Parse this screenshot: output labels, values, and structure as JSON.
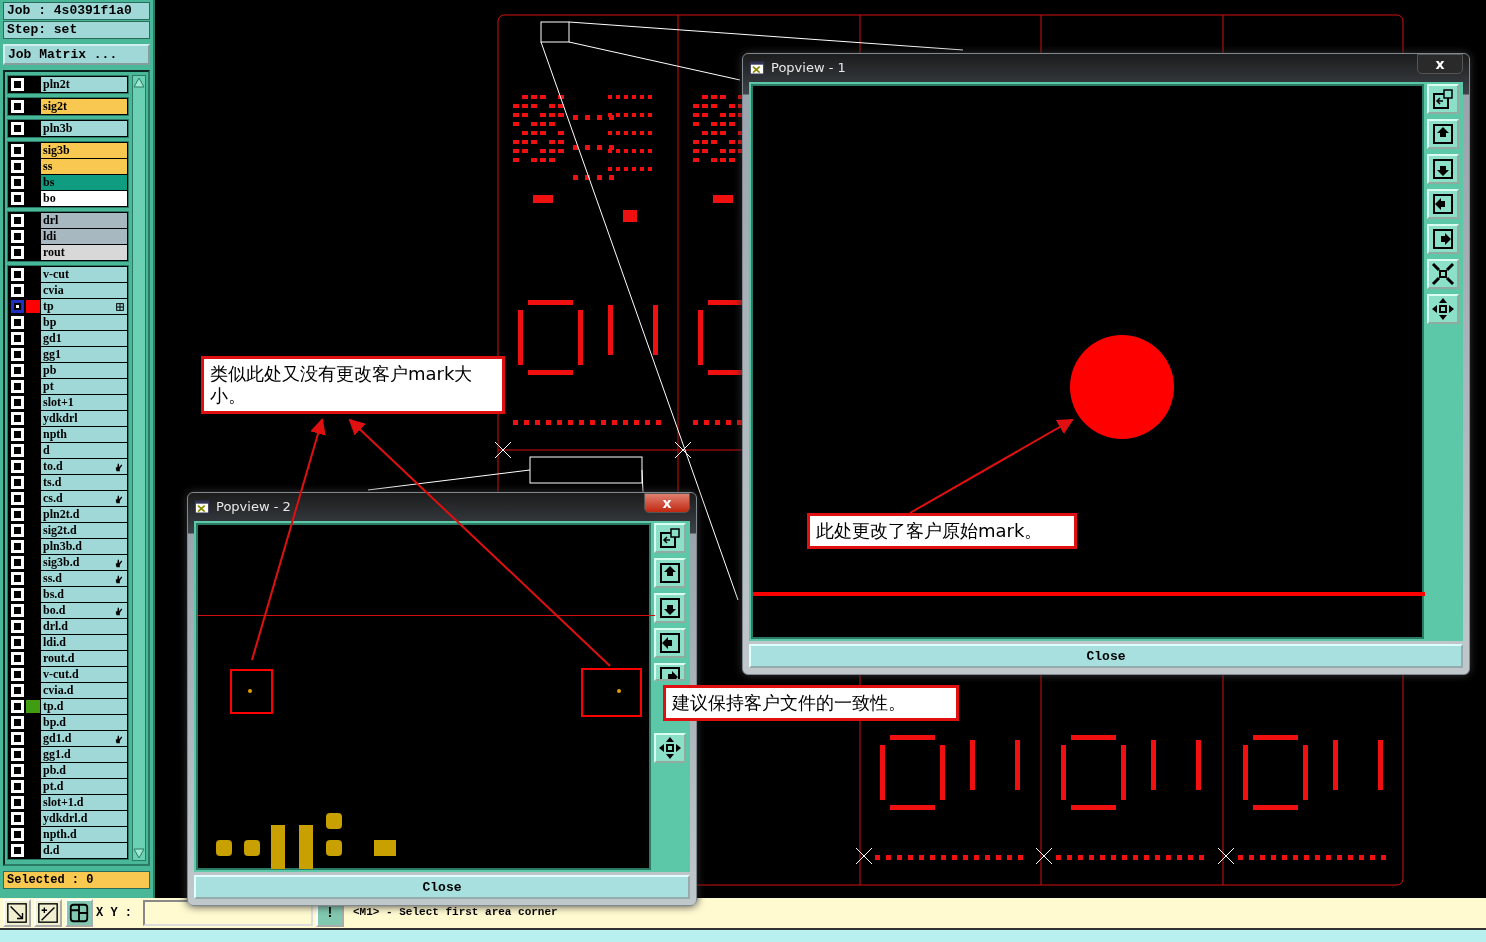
{
  "job_label": "Job : 4s0391f1a0",
  "step_label": "Step: set",
  "matrix_button": "Job Matrix ...",
  "layer_groups": [
    {
      "layers": [
        {
          "name": "pln2t",
          "color": "#a0d8d8",
          "highlighted": false,
          "kind": "plain"
        }
      ]
    },
    {
      "layers": [
        {
          "name": "sig2t",
          "color": "#f8c850",
          "highlighted": false,
          "kind": "plain"
        }
      ]
    },
    {
      "layers": [
        {
          "name": "pln3b",
          "color": "#a0d8d8",
          "highlighted": false,
          "kind": "plain"
        }
      ]
    },
    {
      "layers": [
        {
          "name": "sig3b",
          "color": "#f8c850",
          "highlighted": false,
          "kind": "plain"
        },
        {
          "name": "ss",
          "color": "#f8c850",
          "highlighted": false,
          "kind": "plain"
        },
        {
          "name": "bs",
          "color": "#109c80",
          "highlighted": false,
          "kind": "plain"
        },
        {
          "name": "bo",
          "color": "#ffffff",
          "highlighted": false,
          "kind": "plain"
        }
      ]
    },
    {
      "layers": [
        {
          "name": "drl",
          "color": "#a8b8c0",
          "highlighted": false,
          "kind": "plain"
        },
        {
          "name": "ldi",
          "color": "#a8b8c0",
          "highlighted": false,
          "kind": "plain"
        },
        {
          "name": "rout",
          "color": "#d8d8d8",
          "highlighted": false,
          "kind": "plain"
        }
      ]
    },
    {
      "layers": [
        {
          "name": "v-cut",
          "color": "#a0d8d8",
          "highlighted": false,
          "kind": "plain"
        },
        {
          "name": "cvia",
          "color": "#a0d8d8",
          "highlighted": false,
          "kind": "plain"
        },
        {
          "name": "tp",
          "color": "#a0d8d8",
          "highlighted": true,
          "marker": {
            "color": "#ff0000"
          },
          "kind": "attributed"
        },
        {
          "name": "bp",
          "color": "#a0d8d8",
          "highlighted": false,
          "kind": "plain"
        },
        {
          "name": "gd1",
          "color": "#a0d8d8",
          "highlighted": false,
          "kind": "plain"
        },
        {
          "name": "gg1",
          "color": "#a0d8d8",
          "highlighted": false,
          "kind": "plain"
        },
        {
          "name": "pb",
          "color": "#a0d8d8",
          "highlighted": false,
          "kind": "plain"
        },
        {
          "name": "pt",
          "color": "#a0d8d8",
          "highlighted": false,
          "kind": "plain"
        },
        {
          "name": "slot+1",
          "color": "#a0d8d8",
          "highlighted": false,
          "kind": "plain"
        },
        {
          "name": "ydkdrl",
          "color": "#a0d8d8",
          "highlighted": false,
          "kind": "plain"
        },
        {
          "name": "npth",
          "color": "#a0d8d8",
          "highlighted": false,
          "kind": "plain"
        },
        {
          "name": "d",
          "color": "#a0d8d8",
          "highlighted": false,
          "kind": "plain"
        },
        {
          "name": "to.d",
          "color": "#a0d8d8",
          "highlighted": false,
          "kind": "modified"
        },
        {
          "name": "ts.d",
          "color": "#a0d8d8",
          "highlighted": false,
          "kind": "plain"
        },
        {
          "name": "cs.d",
          "color": "#a0d8d8",
          "highlighted": false,
          "kind": "modified"
        },
        {
          "name": "pln2t.d",
          "color": "#a0d8d8",
          "highlighted": false,
          "kind": "plain"
        },
        {
          "name": "sig2t.d",
          "color": "#a0d8d8",
          "highlighted": false,
          "kind": "plain"
        },
        {
          "name": "pln3b.d",
          "color": "#a0d8d8",
          "highlighted": false,
          "kind": "plain"
        },
        {
          "name": "sig3b.d",
          "color": "#a0d8d8",
          "highlighted": false,
          "kind": "modified"
        },
        {
          "name": "ss.d",
          "color": "#a0d8d8",
          "highlighted": false,
          "kind": "modified"
        },
        {
          "name": "bs.d",
          "color": "#a0d8d8",
          "highlighted": false,
          "kind": "plain"
        },
        {
          "name": "bo.d",
          "color": "#a0d8d8",
          "highlighted": false,
          "kind": "modified"
        },
        {
          "name": "drl.d",
          "color": "#a0d8d8",
          "highlighted": false,
          "kind": "plain"
        },
        {
          "name": "ldi.d",
          "color": "#a0d8d8",
          "highlighted": false,
          "kind": "plain"
        },
        {
          "name": "rout.d",
          "color": "#a0d8d8",
          "highlighted": false,
          "kind": "plain"
        },
        {
          "name": "v-cut.d",
          "color": "#a0d8d8",
          "highlighted": false,
          "kind": "plain"
        },
        {
          "name": "cvia.d",
          "color": "#a0d8d8",
          "highlighted": false,
          "kind": "plain"
        },
        {
          "name": "tp.d",
          "color": "#a0d8d8",
          "highlighted": false,
          "marker": {
            "color": "#409c10"
          },
          "kind": "plain"
        },
        {
          "name": "bp.d",
          "color": "#a0d8d8",
          "highlighted": false,
          "kind": "plain"
        },
        {
          "name": "gd1.d",
          "color": "#a0d8d8",
          "highlighted": false,
          "kind": "modified"
        },
        {
          "name": "gg1.d",
          "color": "#a0d8d8",
          "highlighted": false,
          "kind": "plain"
        },
        {
          "name": "pb.d",
          "color": "#a0d8d8",
          "highlighted": false,
          "kind": "plain"
        },
        {
          "name": "pt.d",
          "color": "#a0d8d8",
          "highlighted": false,
          "kind": "plain"
        },
        {
          "name": "slot+1.d",
          "color": "#a0d8d8",
          "highlighted": false,
          "kind": "plain"
        },
        {
          "name": "ydkdrl.d",
          "color": "#a0d8d8",
          "highlighted": false,
          "kind": "plain"
        },
        {
          "name": "npth.d",
          "color": "#a0d8d8",
          "highlighted": false,
          "kind": "plain"
        },
        {
          "name": "d.d",
          "color": "#a0d8d8",
          "highlighted": false,
          "kind": "plain"
        }
      ]
    }
  ],
  "selected_label": "Selected : 0",
  "coord_label": "X Y :",
  "prompt_button": "!",
  "status_message": "<M1> - Select first area corner",
  "popviews": [
    {
      "title": "Popview - 1",
      "close_glyph": "x",
      "close_active": false,
      "close_button": "Close"
    },
    {
      "title": "Popview - 2",
      "close_glyph": "x",
      "close_active": true,
      "close_button": "Close"
    }
  ],
  "callouts": [
    {
      "text": "类似此处又没有更改客户mark大小。"
    },
    {
      "text": "此处更改了客户原始mark。"
    },
    {
      "text": "建议保持客户文件的一致性。"
    }
  ]
}
